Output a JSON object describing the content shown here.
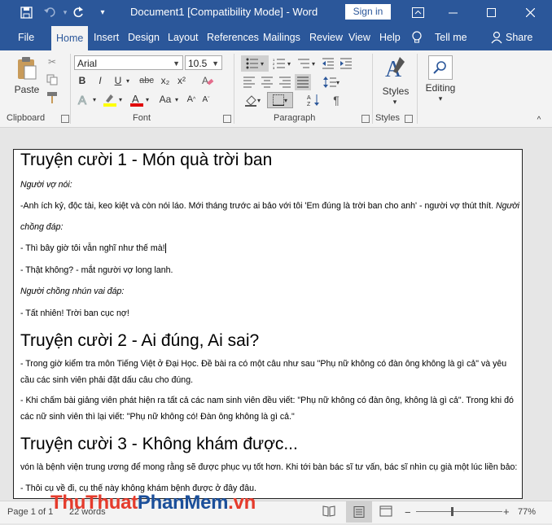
{
  "titlebar": {
    "title": "Document1 [Compatibility Mode]  -  Word",
    "signin": "Sign in",
    "icons": [
      "save-icon",
      "undo-icon",
      "redo-icon",
      "customize-icon",
      "ribbon-display-icon",
      "minimize-icon",
      "maximize-icon",
      "close-icon"
    ]
  },
  "tabs": [
    "File",
    "Home",
    "Insert",
    "Design",
    "Layout",
    "References",
    "Mailings",
    "Review",
    "View",
    "Help",
    "Tell me",
    "Share"
  ],
  "ribbon": {
    "clipboard": {
      "label": "Clipboard",
      "paste": "Paste"
    },
    "font": {
      "label": "Font",
      "name": "Arial",
      "size": "10.5",
      "bold": "B",
      "italic": "I",
      "underline": "U",
      "strike": "abc",
      "sub": "x₂",
      "sup": "x²",
      "case": "Aa"
    },
    "paragraph": {
      "label": "Paragraph"
    },
    "styles": {
      "label": "Styles",
      "button": "Styles"
    },
    "editing": {
      "button": "Editing"
    }
  },
  "document": {
    "lines": [
      {
        "style": "h",
        "text": "Truyện cười 1 - Món quà trời ban"
      },
      {
        "style": "ital",
        "text": "Người vợ nói:"
      },
      {
        "style": "normal",
        "text": "-Anh ích kỷ, độc tài, keo kiệt và còn nói láo. Mới tháng trước ai bảo với tôi 'Em đúng là trời ban cho anh' - người vợ thút thít.",
        "tail": " Người"
      },
      {
        "style": "ital",
        "text": "chồng đáp:"
      },
      {
        "style": "normal",
        "text": "-    Thì bây giờ tôi vẫn nghĩ như thế mà!"
      },
      {
        "style": "normal",
        "text": "-    Thật không? - mắt người vợ long lanh."
      },
      {
        "style": "ital",
        "text": "Người chồng nhún vai đáp:"
      },
      {
        "style": "normal",
        "text": "-    Tất nhiên! Trời ban cục nợ!"
      },
      {
        "style": "h",
        "text": "Truyện cười 2 - Ai đúng, Ai sai?"
      },
      {
        "style": "normal",
        "text": "-    Trong giờ kiểm tra môn Tiếng Việt ở Đại Học. Đề bài ra có một câu như sau \"Phụ nữ không có đàn ông không là gì cả\" và yêu"
      },
      {
        "style": "normal",
        "text": "cầu các sinh viên phải đặt dấu câu cho đúng."
      },
      {
        "style": "normal",
        "text": "-    Khi chấm bài giảng viên phát hiện ra tất cả các nam sinh viên đều viết: \"Phụ nữ không có đàn ông, không là gì cả\". Trong khi đó"
      },
      {
        "style": "normal",
        "text": "các nữ sinh viên thì lại viết: \"Phụ nữ không có! Đàn ông không là gì cả.\""
      },
      {
        "style": "h",
        "text": "Truyện cười 3 - Không khám được..."
      },
      {
        "style": "normal",
        "text": "vón là bệnh viện trung ương để mong rằng sẽ được phục vụ tốt hơn. Khi tới bàn bác sĩ tư vấn, bác sĩ nhìn cụ già một lúc liền bảo:"
      },
      {
        "style": "normal",
        "text": "-    Thôi cụ về đi, cụ thế này không khám bệnh được ở đây đâu."
      }
    ]
  },
  "status": {
    "page": "Page 1 of 1",
    "words": "22 words",
    "zoom": "77%"
  },
  "watermark": {
    "part1": "ThuThuat",
    "part2": "PhanMem",
    "part3": ".vn"
  }
}
